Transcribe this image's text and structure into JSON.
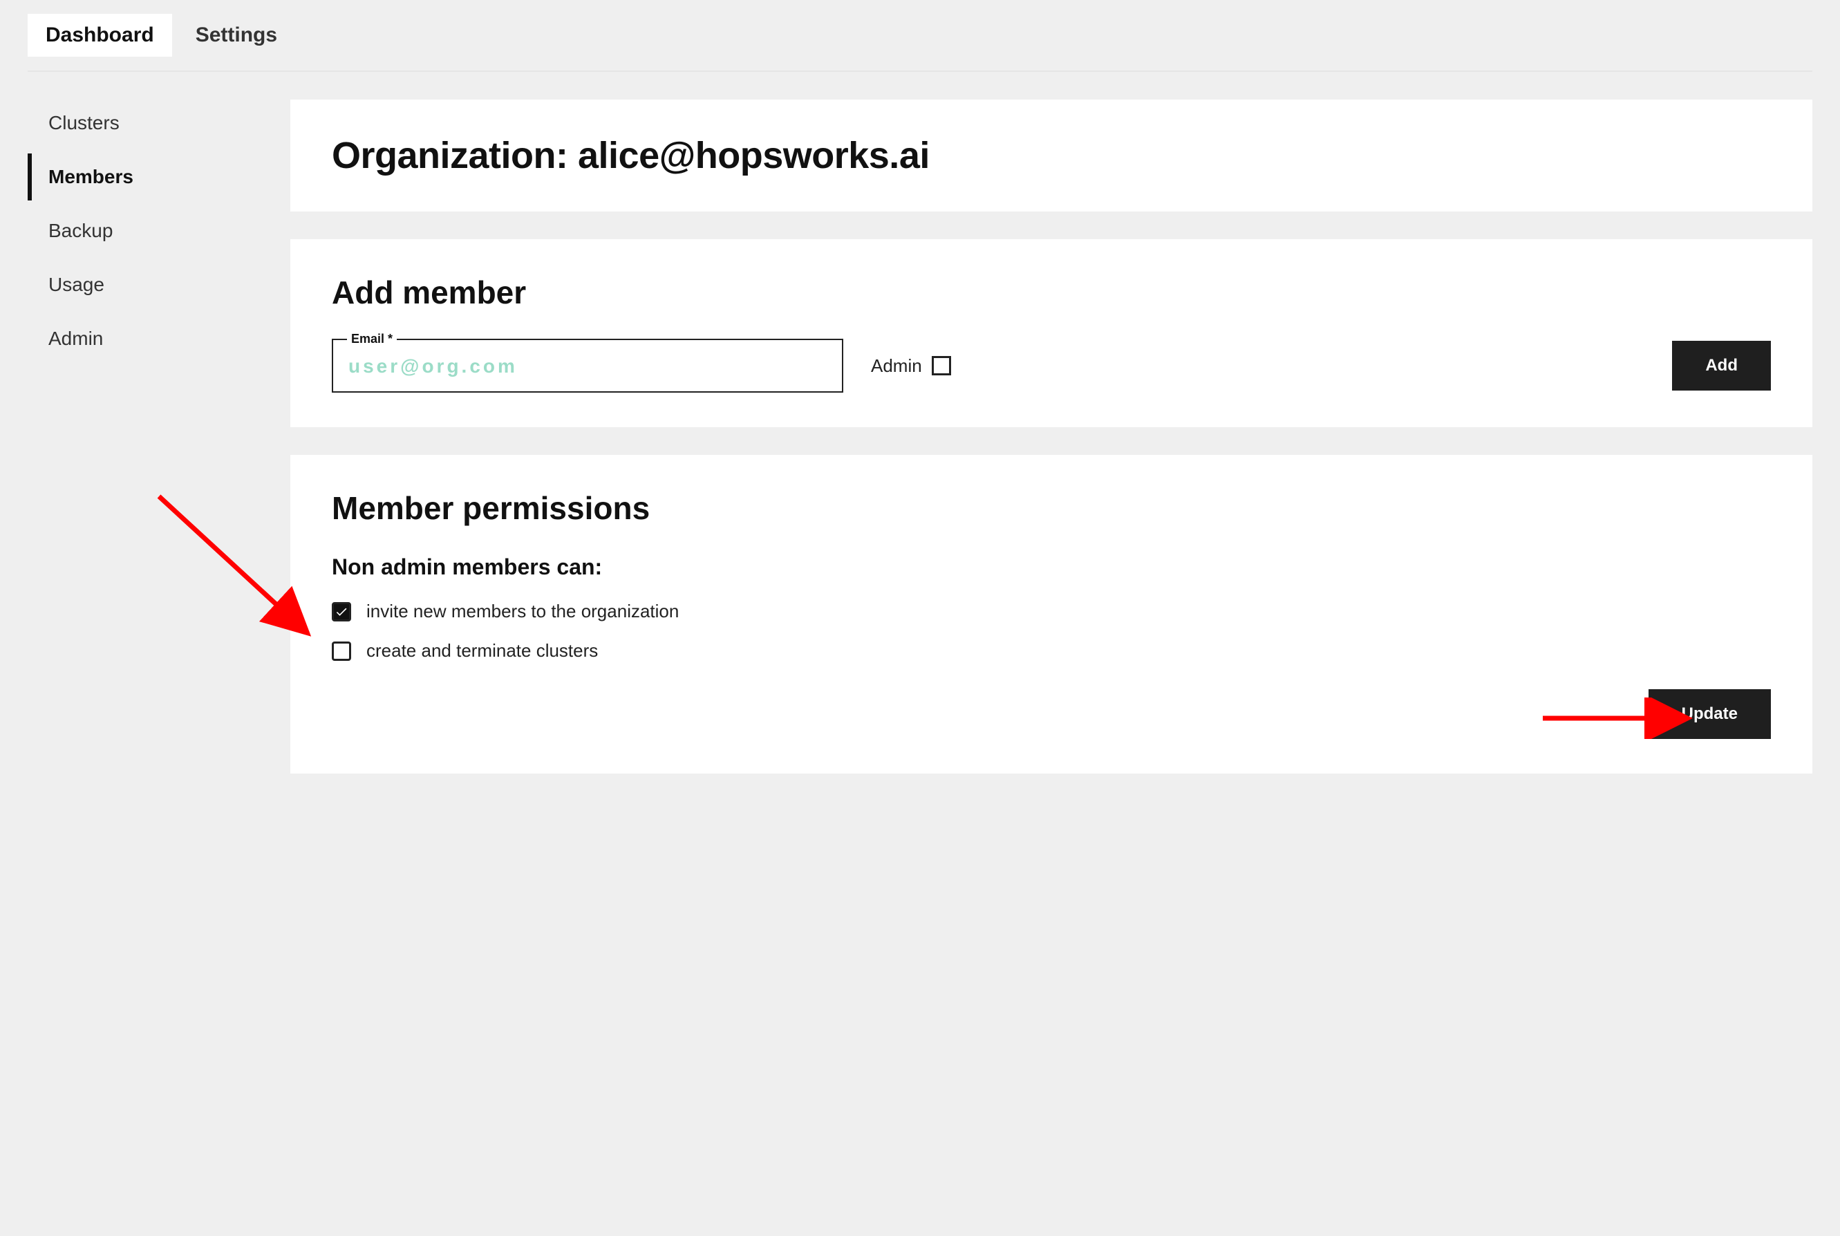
{
  "topnav": {
    "tabs": [
      {
        "label": "Dashboard",
        "active": true
      },
      {
        "label": "Settings",
        "active": false
      }
    ]
  },
  "sidebar": {
    "items": [
      {
        "label": "Clusters",
        "active": false
      },
      {
        "label": "Members",
        "active": true
      },
      {
        "label": "Backup",
        "active": false
      },
      {
        "label": "Usage",
        "active": false
      },
      {
        "label": "Admin",
        "active": false
      }
    ]
  },
  "header": {
    "title": "Organization: alice@hopsworks.ai"
  },
  "add_member": {
    "section_title": "Add member",
    "email_label": "Email *",
    "email_placeholder": "user@org.com",
    "email_value": "",
    "admin_label": "Admin",
    "admin_checked": false,
    "add_button": "Add"
  },
  "permissions": {
    "section_title": "Member permissions",
    "sub_title": "Non admin members can:",
    "items": [
      {
        "label": "invite new members to the organization",
        "checked": true
      },
      {
        "label": "create and terminate clusters",
        "checked": false
      }
    ],
    "update_button": "Update"
  },
  "annotations": {
    "arrow_color": "#ff0000"
  }
}
